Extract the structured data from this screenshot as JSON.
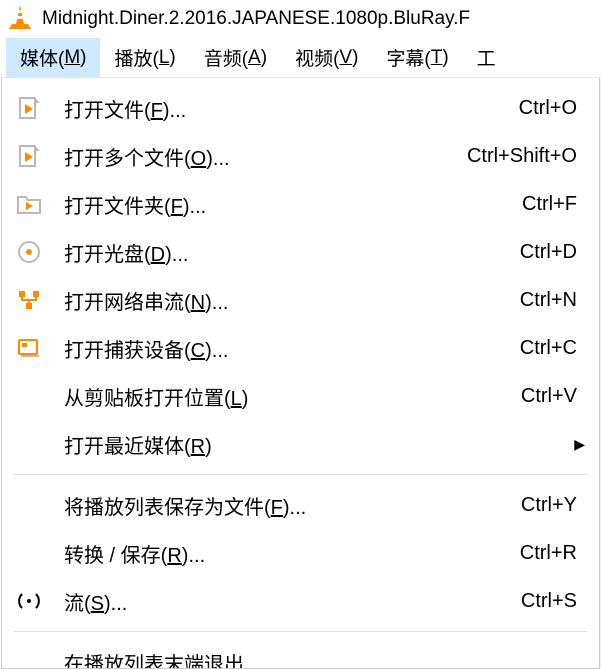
{
  "title": "Midnight.Diner.2.2016.JAPANESE.1080p.BluRay.F",
  "menubar": {
    "media": {
      "pre": "媒体(",
      "hot": "M",
      "post": ")"
    },
    "play": {
      "pre": "播放(",
      "hot": "L",
      "post": ")"
    },
    "audio": {
      "pre": "音频(",
      "hot": "A",
      "post": ")"
    },
    "video": {
      "pre": "视频(",
      "hot": "V",
      "post": ")"
    },
    "sub": {
      "pre": "字幕(",
      "hot": "T",
      "post": ")"
    },
    "tools": {
      "pre": "工",
      "hot": "",
      "post": ""
    }
  },
  "menu": {
    "open_file": {
      "pre": "打开文件(",
      "hot": "F",
      "post": ")...",
      "sc": "Ctrl+O"
    },
    "open_multi": {
      "pre": "打开多个文件(",
      "hot": "O",
      "post": ")...",
      "sc": "Ctrl+Shift+O"
    },
    "open_folder": {
      "pre": "打开文件夹(",
      "hot": "F",
      "post": ")...",
      "sc": "Ctrl+F"
    },
    "open_disc": {
      "pre": "打开光盘(",
      "hot": "D",
      "post": ")...",
      "sc": "Ctrl+D"
    },
    "open_network": {
      "pre": "打开网络串流(",
      "hot": "N",
      "post": ")...",
      "sc": "Ctrl+N"
    },
    "open_capture": {
      "pre": "打开捕获设备(",
      "hot": "C",
      "post": ")...",
      "sc": "Ctrl+C"
    },
    "open_clipboard": {
      "pre": "从剪贴板打开位置(",
      "hot": "L",
      "post": ")",
      "sc": "Ctrl+V"
    },
    "open_recent": {
      "pre": "打开最近媒体(",
      "hot": "R",
      "post": ")",
      "sc": ""
    },
    "save_playlist": {
      "pre": "将播放列表保存为文件(",
      "hot": "F",
      "post": ")...",
      "sc": "Ctrl+Y"
    },
    "convert": {
      "pre": "转换 / 保存(",
      "hot": "R",
      "post": ")...",
      "sc": "Ctrl+R"
    },
    "stream": {
      "pre": "流(",
      "hot": "S",
      "post": ")...",
      "sc": "Ctrl+S"
    },
    "quit_partial": {
      "label": "在播放列表末端退出"
    }
  }
}
